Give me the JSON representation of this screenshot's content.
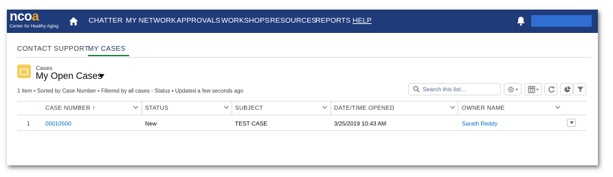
{
  "brand": {
    "logo_word_a": "nco",
    "logo_word_b": "a",
    "logo_tagline": "Center for Healthy Aging"
  },
  "nav": {
    "items": [
      "CHATTER",
      "MY NETWORK",
      "APPROVALS",
      "WORKSHOPS",
      "RESOURCES",
      "REPORTS",
      "HELP"
    ],
    "home_icon": "home-icon",
    "bell_icon": "bell-icon"
  },
  "tabs": [
    {
      "label": "CONTACT SUPPORT",
      "active": false
    },
    {
      "label": "MY CASES",
      "active": true
    }
  ],
  "list": {
    "object_label": "Cases",
    "view_name": "My Open Cases",
    "info": "1 item • Sorted by Case Number • Filtered by all cases - Status • Updated a few seconds ago",
    "search_placeholder": "Search this list..."
  },
  "table": {
    "columns": [
      "CASE NUMBER",
      "STATUS",
      "SUBJECT",
      "DATE/TIME OPENED",
      "OWNER NAME"
    ],
    "sort_indicator": "↑",
    "rows": [
      {
        "num": "1",
        "case_number": "00010500",
        "status": "New",
        "subject": "TEST CASE",
        "opened": "3/25/2019 10:43 AM",
        "owner": "Sarath Reddy"
      }
    ]
  },
  "colors": {
    "nav_bg": "#1f3b7a",
    "accent_green": "#1b8a3a",
    "link_blue": "#006dcc",
    "cases_icon": "#f2cf5b"
  }
}
